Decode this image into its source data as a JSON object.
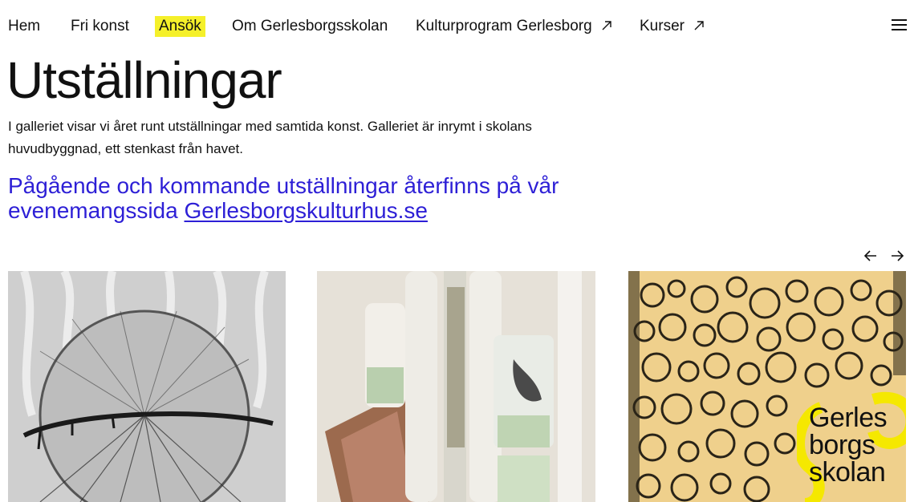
{
  "nav": {
    "items": [
      {
        "label": "Hem"
      },
      {
        "label": "Fri konst"
      },
      {
        "label": "Ansök"
      },
      {
        "label": "Om Gerlesborgsskolan"
      },
      {
        "label": "Kulturprogram Gerlesborg"
      },
      {
        "label": "Kurser"
      }
    ],
    "active_highlight_color": "#f5f02a"
  },
  "page": {
    "title": "Utställningar",
    "intro": "I galleriet visar vi året runt utställningar med samtida konst. Galleriet är inrymt i skolans huvudbyggnad, ett stenkast från havet.",
    "lead_text": "Pågående och kommande utställningar återfinns på vår evenemangssida ",
    "lead_link": "Gerlesborgskulturhus.se",
    "accent_color": "#2d1fd6"
  },
  "gallery": {
    "prev_icon": "arrow-left-icon",
    "next_icon": "arrow-right-icon",
    "logo_lines": [
      "Gerles",
      "borgs",
      "skolan"
    ],
    "logo_color": "#f5e800"
  }
}
